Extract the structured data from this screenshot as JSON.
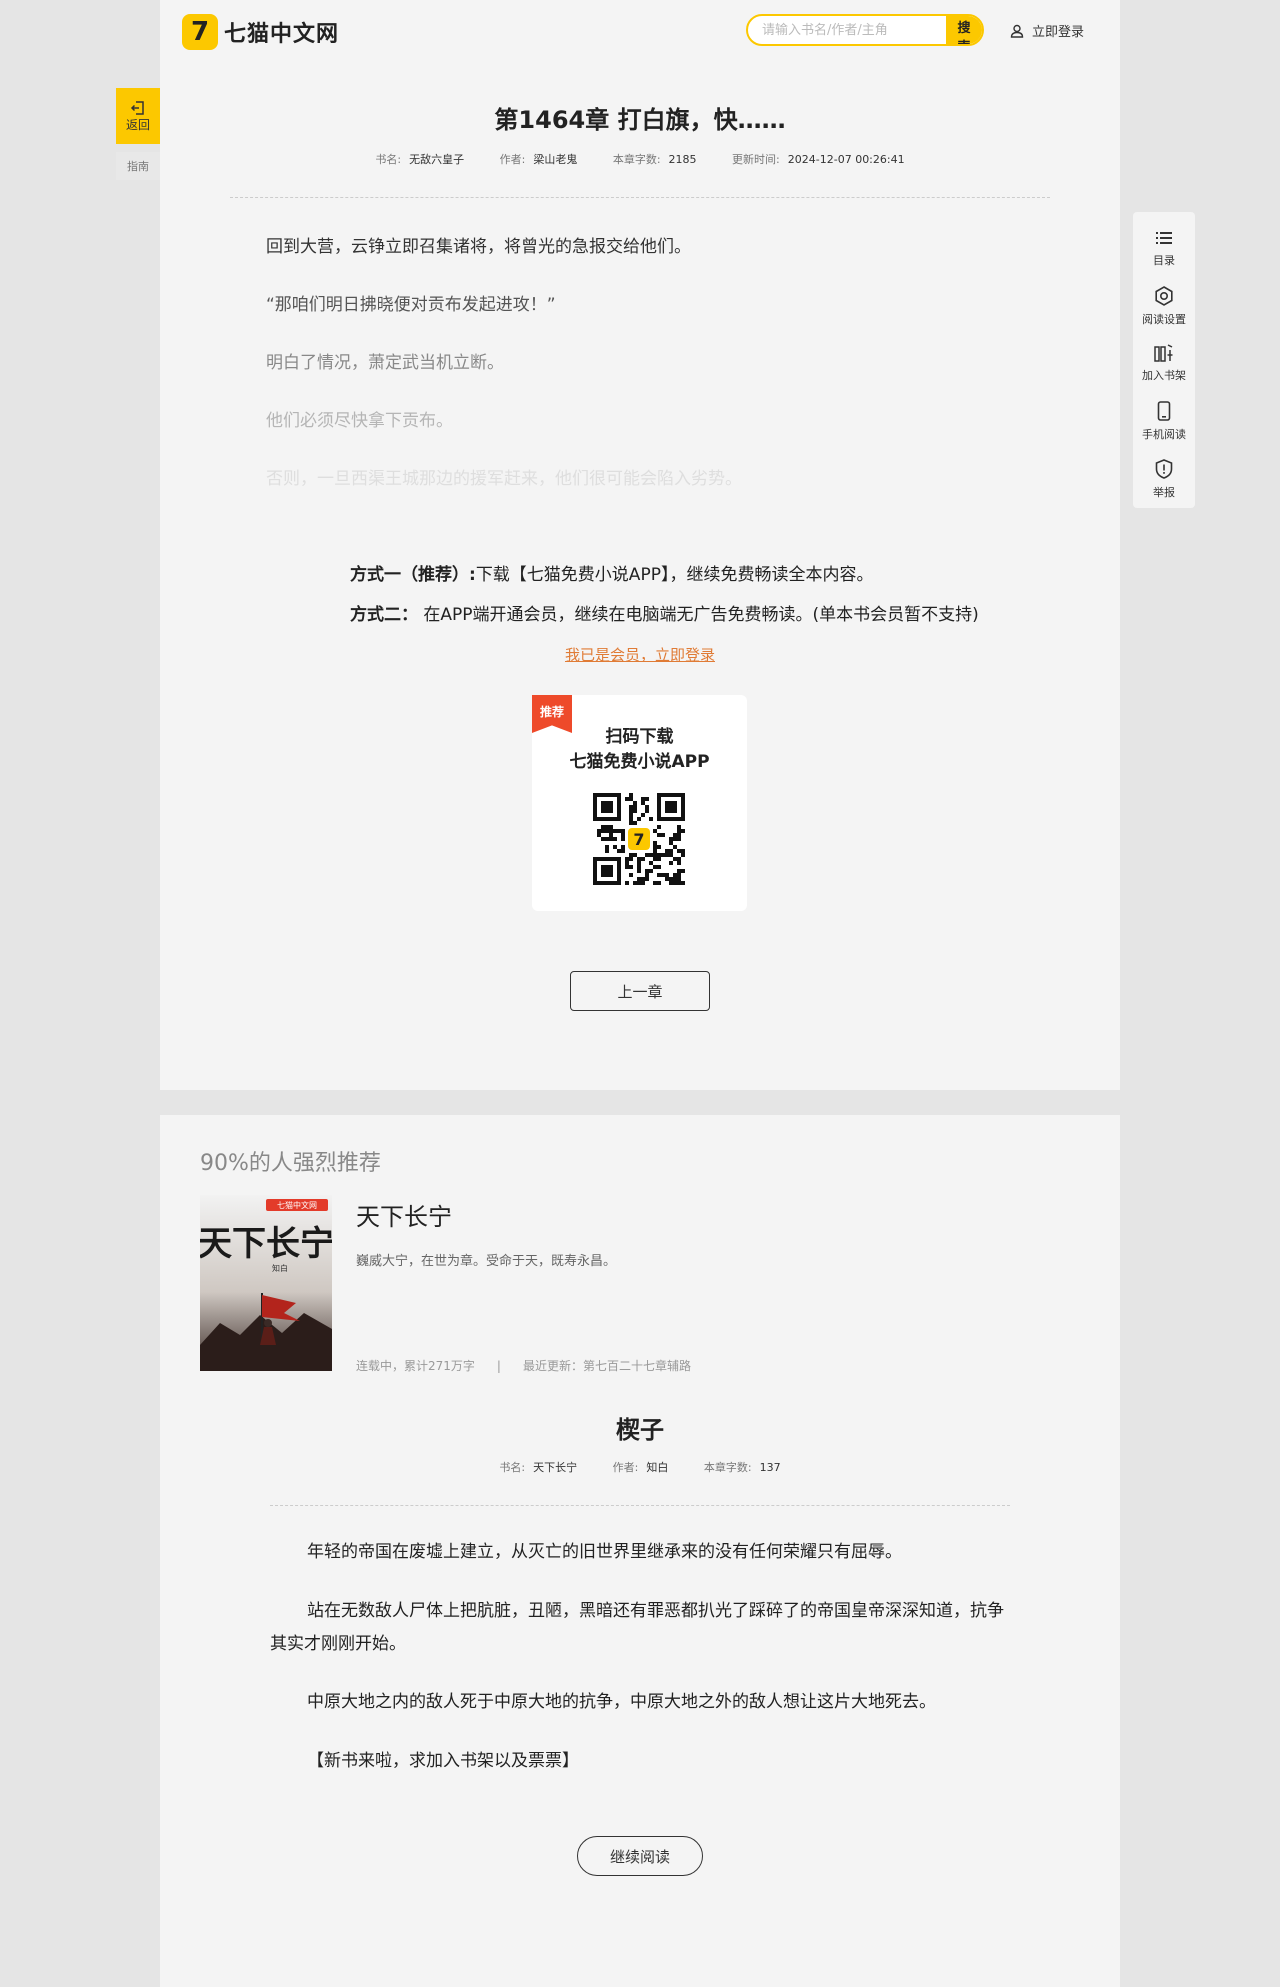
{
  "header": {
    "logo_text": "七猫中文网",
    "search_placeholder": "请输入书名/作者/主角",
    "search_button": "搜索",
    "login_label": "立即登录"
  },
  "left_nav": {
    "back_label": "返回",
    "guide_label": "指南"
  },
  "toolbar": [
    {
      "icon": "list-icon",
      "label": "目录"
    },
    {
      "icon": "gear-icon",
      "label": "阅读设置"
    },
    {
      "icon": "bookshelf-add-icon",
      "label": "加入书架"
    },
    {
      "icon": "phone-icon",
      "label": "手机阅读"
    },
    {
      "icon": "report-shield-icon",
      "label": "举报"
    }
  ],
  "chapter": {
    "title": "第1464章 打白旗，快……",
    "meta": [
      {
        "label": "书名:",
        "value": "无敌六皇子"
      },
      {
        "label": "作者:",
        "value": "梁山老鬼"
      },
      {
        "label": "本章字数:",
        "value": "2185"
      },
      {
        "label": "更新时间:",
        "value": "2024-12-07 00:26:41"
      }
    ],
    "paragraphs": [
      "回到大营，云铮立即召集诸将，将曾光的急报交给他们。",
      "“那咱们明日拂晓便对贡布发起进攻！”",
      "明白了情况，萧定武当机立断。",
      "他们必须尽快拿下贡布。",
      "否则，一旦西渠王城那边的援军赶来，他们很可能会陷入劣势。"
    ]
  },
  "paywall": {
    "method1_label": "方式一（推荐）:",
    "method1_text": "下载【七猫免费小说APP】，继续免费畅读全本内容。",
    "method2_label": "方式二：",
    "method2_text": "在APP端开通会员，继续在电脑端无广告免费畅读。(单本书会员暂不支持)",
    "member_link": "我已是会员，立即登录",
    "qr_badge": "推荐",
    "qr_line1": "扫码下载",
    "qr_line2": "七猫免费小说APP",
    "prev_button": "上一章"
  },
  "recommendation": {
    "section_title": "90%的人强烈推荐",
    "book": {
      "cover_brand": "七猫中文网",
      "cover_title": "天下长宁",
      "cover_author": "知白",
      "name": "天下长宁",
      "description": "巍威大宁，在世为章。受命于天，既寿永昌。",
      "status": "连载中，累计271万字",
      "separator": "|",
      "latest": "最近更新：第七百二十七章辅路"
    },
    "prologue": {
      "title": "楔子",
      "meta": [
        {
          "label": "书名:",
          "value": "天下长宁"
        },
        {
          "label": "作者:",
          "value": "知白"
        },
        {
          "label": "本章字数:",
          "value": "137"
        }
      ],
      "paragraphs": [
        "年轻的帝国在废墟上建立，从灭亡的旧世界里继承来的没有任何荣耀只有屈辱。",
        "站在无数敌人尸体上把肮脏，丑陋，黑暗还有罪恶都扒光了踩碎了的帝国皇帝深深知道，抗争其实才刚刚开始。",
        "中原大地之内的敌人死于中原大地的抗争，中原大地之外的敌人想让这片大地死去。",
        "【新书来啦，求加入书架以及票票】"
      ],
      "continue_button": "继续阅读"
    }
  },
  "colors": {
    "brand_yellow": "#fcc800",
    "link_orange": "#e07b35",
    "badge_red": "#ee4a2a"
  }
}
